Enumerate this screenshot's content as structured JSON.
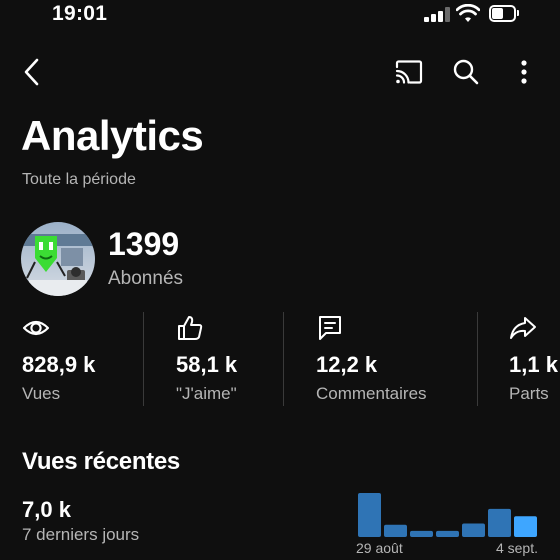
{
  "status_bar": {
    "time": "19:01"
  },
  "header": {
    "back_icon": "chevron-left-icon",
    "actions": [
      "cast-icon",
      "search-icon",
      "more-vert-icon"
    ],
    "title": "Analytics",
    "period": "Toute la période"
  },
  "channel": {
    "subscriber_count": "1399",
    "subscriber_label": "Abonnés"
  },
  "metrics": [
    {
      "icon": "eye-icon",
      "value": "828,9 k",
      "label": "Vues"
    },
    {
      "icon": "thumbs-up-icon",
      "value": "58,1 k",
      "label": "\"J'aime\""
    },
    {
      "icon": "comment-icon",
      "value": "12,2 k",
      "label": "Commentaires"
    },
    {
      "icon": "share-icon",
      "value": "1,1 k",
      "label": "Parts"
    }
  ],
  "recent_views": {
    "title": "Vues récentes",
    "value": "7,0 k",
    "period": "7 derniers jours"
  },
  "colors": {
    "bar": "#2f74b5",
    "bar_highlight": "#3ea6ff",
    "background": "#0f0f0f"
  },
  "chart_data": {
    "type": "bar",
    "categories": [
      "",
      "",
      "",
      "",
      "",
      "",
      ""
    ],
    "values": [
      1.8,
      0.5,
      0.25,
      0.25,
      0.55,
      1.15,
      0.85
    ],
    "tick_labels": [
      "29 août",
      "4 sept."
    ],
    "highlight_index": 6,
    "title": "",
    "xlabel": "",
    "ylabel": ""
  }
}
